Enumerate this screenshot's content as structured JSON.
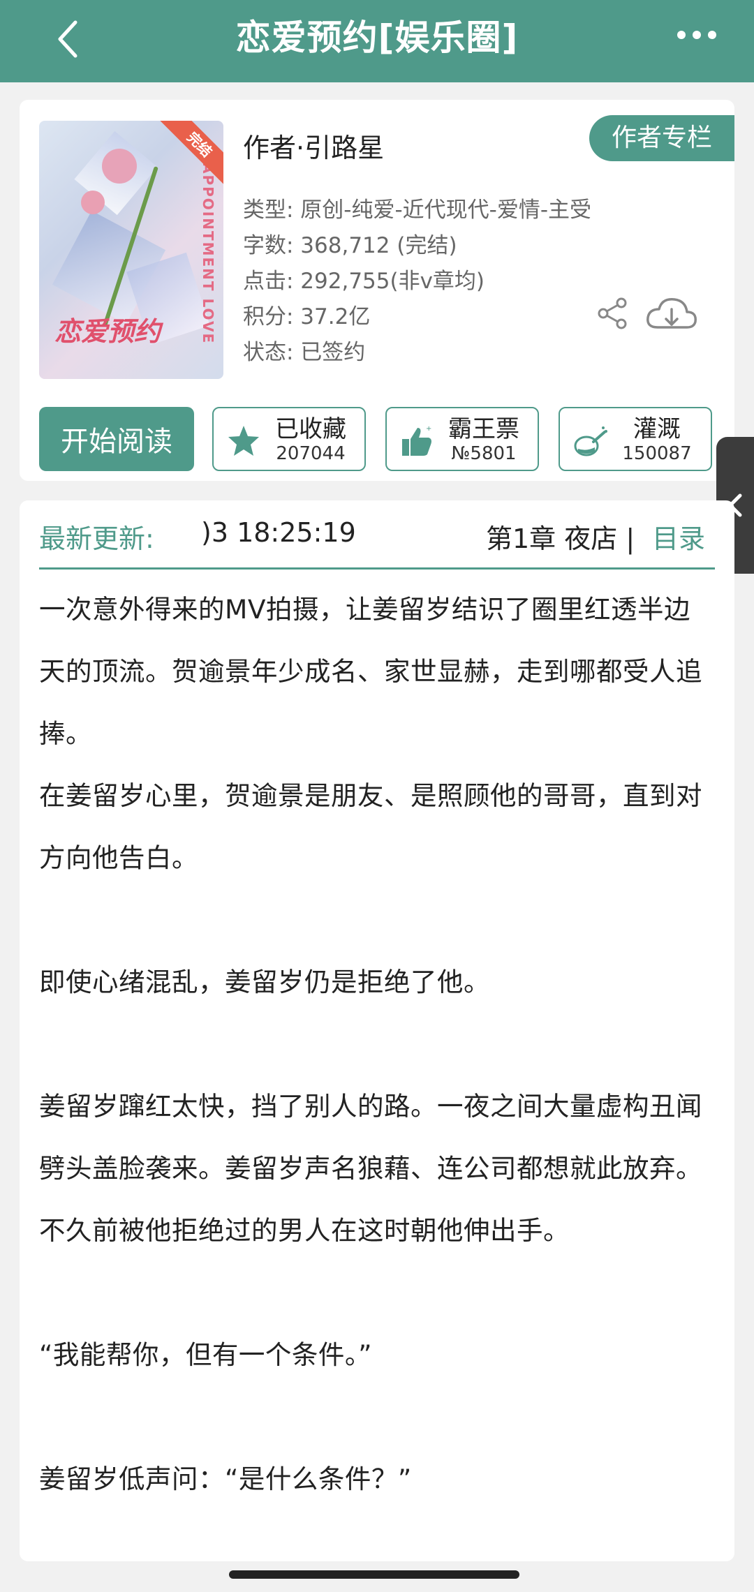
{
  "header": {
    "title": "恋爱预约[娱乐圈]",
    "back_icon": "chevron-left-icon",
    "more_icon": "more-horizontal-icon"
  },
  "book": {
    "cover": {
      "title_art": "恋爱预约",
      "side_text": "APPOINTMENT LOVE",
      "ribbon": "完结"
    },
    "author": "作者·引路星",
    "author_column_label": "作者专栏",
    "meta": {
      "type": "类型: 原创-纯爱-近代现代-爱情-主受",
      "words": "字数: 368,712 (完结)",
      "clicks": "点击: 292,755(非v章均)",
      "score": "积分: 37.2亿",
      "status": "状态: 已签约"
    }
  },
  "actions": {
    "read": "开始阅读",
    "favorite": {
      "label": "已收藏",
      "count": "207044",
      "icon": "star-icon"
    },
    "ticket": {
      "label": "霸王票",
      "count": "№5801",
      "icon": "thumbs-up-icon"
    },
    "water": {
      "label": "灌溉",
      "count": "150087",
      "icon": "watering-can-icon"
    }
  },
  "update": {
    "label": "最新更新:",
    "time": ")3 18:25:19",
    "chapter": "第1章   夜店 |",
    "toc": "目录"
  },
  "description": [
    "一次意外得来的MV拍摄，让姜留岁结识了圈里红透半边天的顶流。贺逾景年少成名、家世显赫，走到哪都受人追捧。",
    "在姜留岁心里，贺逾景是朋友、是照顾他的哥哥，直到对方向他告白。",
    "",
    "即使心绪混乱，姜留岁仍是拒绝了他。",
    "",
    "姜留岁蹿红太快，挡了别人的路。一夜之间大量虚构丑闻劈头盖脸袭来。姜留岁声名狼藉、连公司都想就此放弃。不久前被他拒绝过的男人在这时朝他伸出手。",
    "",
    "“我能帮你，但有一个条件。”",
    "",
    "姜留岁低声问：“是什么条件？”"
  ],
  "colors": {
    "accent": "#4f9a8a",
    "background": "#f1f1f1"
  }
}
